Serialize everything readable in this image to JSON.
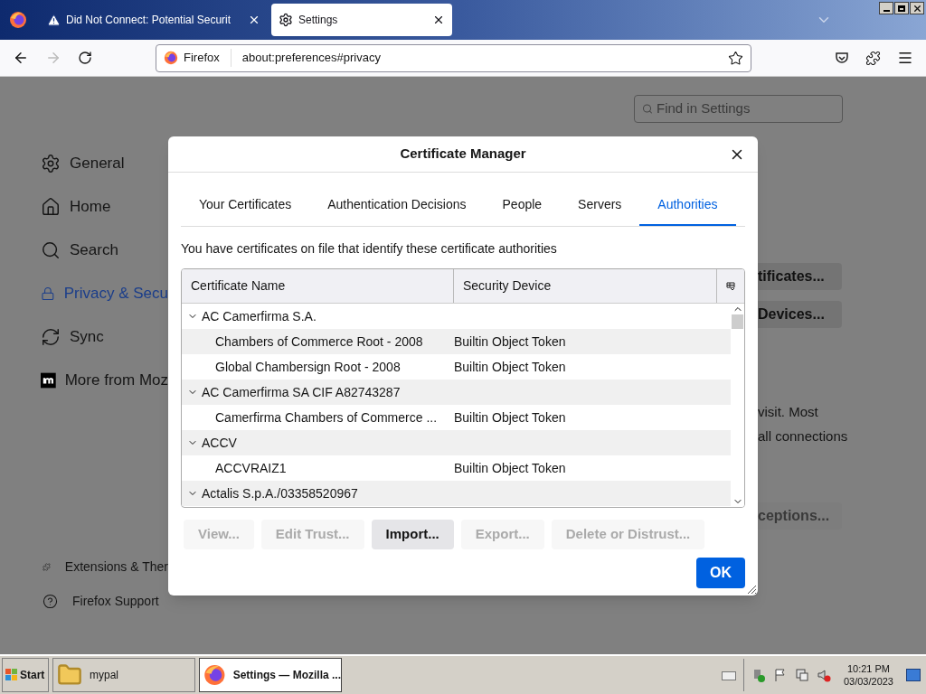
{
  "browser": {
    "tabs": [
      {
        "title": "Did Not Connect: Potential Securit",
        "kind": "warning",
        "selected": false
      },
      {
        "title": "Settings",
        "kind": "settings",
        "selected": true
      }
    ],
    "identity": "Firefox",
    "url": "about:preferences#privacy"
  },
  "settings": {
    "search": {
      "placeholder": "Find in Settings"
    },
    "nav": [
      {
        "label": "General",
        "selected": false
      },
      {
        "label": "Home",
        "selected": false
      },
      {
        "label": "Search",
        "selected": false
      },
      {
        "label": "Privacy & Secu",
        "selected": true
      },
      {
        "label": "Sync",
        "selected": false
      },
      {
        "label": "More from Moz",
        "selected": false
      }
    ],
    "footer": [
      {
        "label": "Extensions & Ther"
      },
      {
        "label": "Firefox Support"
      }
    ],
    "fragments": [
      {
        "text": "tificates...",
        "kind": "button",
        "disabled": false
      },
      {
        "text": "Devices...",
        "kind": "button",
        "disabled": false
      },
      {
        "text": "visit. Most",
        "kind": "text"
      },
      {
        "text": "all connections",
        "kind": "text"
      },
      {
        "text": "ceptions...",
        "kind": "button",
        "disabled": true
      }
    ]
  },
  "dialog": {
    "title": "Certificate Manager",
    "tabs": [
      {
        "label": "Your Certificates",
        "selected": false
      },
      {
        "label": "Authentication Decisions",
        "selected": false
      },
      {
        "label": "People",
        "selected": false
      },
      {
        "label": "Servers",
        "selected": false
      },
      {
        "label": "Authorities",
        "selected": true
      }
    ],
    "description": "You have certificates on file that identify these certificate authorities",
    "columns": [
      "Certificate Name",
      "Security Device"
    ],
    "groups": [
      {
        "name": "AC Camerfirma S.A.",
        "expanded": true,
        "children": [
          {
            "name": "Chambers of Commerce Root - 2008",
            "device": "Builtin Object Token"
          },
          {
            "name": "Global Chambersign Root - 2008",
            "device": "Builtin Object Token"
          }
        ]
      },
      {
        "name": "AC Camerfirma SA CIF A82743287",
        "expanded": true,
        "children": [
          {
            "name": "Camerfirma Chambers of Commerce ...",
            "device": "Builtin Object Token"
          }
        ]
      },
      {
        "name": "ACCV",
        "expanded": true,
        "children": [
          {
            "name": "ACCVRAIZ1",
            "device": "Builtin Object Token"
          }
        ]
      },
      {
        "name": "Actalis S.p.A./03358520967",
        "expanded": true
      }
    ],
    "buttons": [
      {
        "label": "View...",
        "disabled": true
      },
      {
        "label": "Edit Trust...",
        "disabled": true
      },
      {
        "label": "Import...",
        "disabled": false
      },
      {
        "label": "Export...",
        "disabled": true
      },
      {
        "label": "Delete or Distrust...",
        "disabled": true
      }
    ],
    "ok": "OK"
  },
  "taskbar": {
    "start": "Start",
    "items": [
      {
        "label": "mypal",
        "selected": false
      },
      {
        "label": "Settings — Mozilla ...",
        "selected": true
      }
    ],
    "time": "10:21 PM",
    "date": "03/03/2023"
  }
}
